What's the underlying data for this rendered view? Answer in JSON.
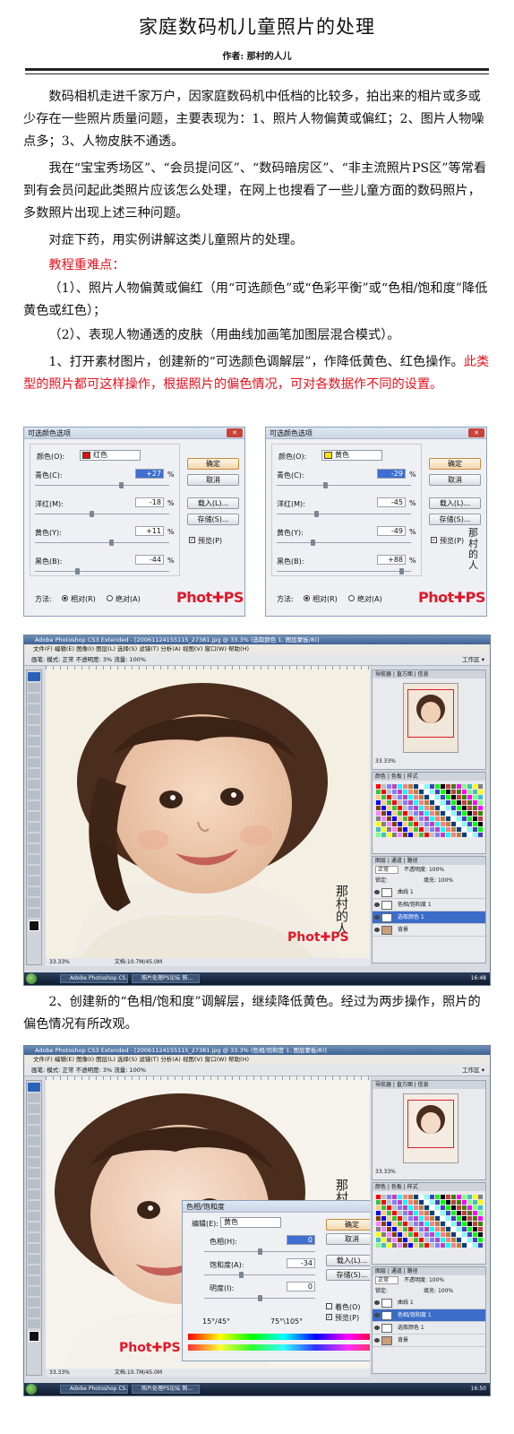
{
  "article": {
    "title": "家庭数码机儿童照片的处理",
    "author": "作者: 那村的人儿",
    "p1": "数码相机走进千家万户，因家庭数码机中低档的比较多，拍出来的相片或多或少存在一些照片质量问题，主要表现为：1、照片人物偏黄或偏红；2、图片人物噪点多；3、人物皮肤不通透。",
    "p2": "我在“宝宝秀场区”、“会员提问区”、“数码暗房区”、“非主流照片PS区”等常看到有会员问起此类照片应该怎么处理，在网上也搜看了一些儿童方面的数码照片，多数照片出现上述三种问题。",
    "p3": "对症下药，用实例讲解这类儿童照片的处理。",
    "key_heading": "教程重难点：",
    "key1": "（1）、照片人物偏黄或偏红（用“可选颜色”或“色彩平衡”或“色相/饱和度”降低黄色或红色）；",
    "key2": "（2）、表现人物通透的皮肤（用曲线加画笔加图层混合模式）。",
    "step1_black": "1、打开素材图片，创建新的“可选颜色调解层”，作降低黄色、红色操作。",
    "step1_red": "此类型的照片都可这样操作，根据照片的偏色情况，可对各数据作不同的设置。",
    "step2": "2、创建新的“色相/饱和度”调解层，继续降低黄色。经过为两步操作，照片的偏色情况有所改观。"
  },
  "dialog_common": {
    "title": "可选颜色选项",
    "color_label": "颜色(O):",
    "cyan_label": "青色(C):",
    "magenta_label": "洋红(M):",
    "yellow_label": "黄色(Y):",
    "black_label": "黑色(B):",
    "pct": "%",
    "ok": "确定",
    "cancel": "取消",
    "load": "载入(L)...",
    "save": "存储(S)...",
    "preview": "预览(P)",
    "method_label": "方法:",
    "relative": "相对(R)",
    "absolute": "绝对(A)",
    "logo_a": "Phot",
    "logo_b": "PS",
    "watermark": "那村的人儿"
  },
  "dialog_red": {
    "color_value": "红色",
    "swatch": "#e01010",
    "cyan": "+27",
    "magenta": "-18",
    "yellow": "+11",
    "black": "-44"
  },
  "dialog_yellow": {
    "color_value": "黄色",
    "swatch": "#f5e400",
    "cyan": "-29",
    "magenta": "-45",
    "yellow": "-49",
    "black": "+88"
  },
  "ps1": {
    "window_title": "Adobe Photoshop CS3 Extended - [20061124155115_27381.jpg @ 33.3% (选取颜色 1, 图层蒙板/8)]",
    "menu": "文件(F)  编辑(E)  图像(I)  图层(L)  选择(S)  滤镜(T)  分析(A)  视图(V)  窗口(W)  帮助(H)",
    "options": "画笔:   模式: 正常      不透明度: 3%    流量: 100%",
    "workspace": "工作区 ▾",
    "zoom": "33.33%",
    "doc": "文档:10.7M/45.0M",
    "nav_tabs": "导航器 | 直方图 | 信息",
    "nav_zoom": "33.33%",
    "swatch_tabs": "颜色 | 色板 | 样式",
    "layer_tabs": "图层 | 通道 | 路径",
    "blend": "正常",
    "opacity": "不透明度: 100%",
    "lock": "锁定:",
    "fill": "填充: 100%",
    "layers": [
      "曲线 1",
      "色相/饱和度 1",
      "选取颜色 1",
      "背景"
    ],
    "task1": "Adobe Photoshop CS...",
    "task2": "照片处理PS论坛 照...",
    "clock": "16:48"
  },
  "ps2": {
    "window_title": "Adobe Photoshop CS3 Extended - [20061124155115_27381.jpg @ 33.3% (色相/饱和度 1, 图层蒙板/8)]",
    "zoom": "33.33%",
    "doc": "文档:10.7M/45.0M",
    "layers": [
      "曲线 1",
      "色相/饱和度 1",
      "选取颜色 1",
      "背景"
    ],
    "clock": "16:50",
    "hs": {
      "title": "色相/饱和度",
      "edit_label": "编辑(E):",
      "edit_value": "黄色",
      "hue_label": "色相(H):",
      "hue": "0",
      "sat_label": "饱和度(A):",
      "sat": "-34",
      "light_label": "明度(I):",
      "light": "0",
      "range_a": "15°/45°",
      "range_b": "75°\\105°",
      "colorize": "着色(O)",
      "preview": "预览(P)",
      "ok": "确定",
      "cancel": "取消",
      "load": "载入(L)...",
      "save": "存储(S)..."
    }
  },
  "colors": {
    "red_text": "#e8101c",
    "ps_title": "#3f6294",
    "highlight": "#3b6dc9"
  }
}
